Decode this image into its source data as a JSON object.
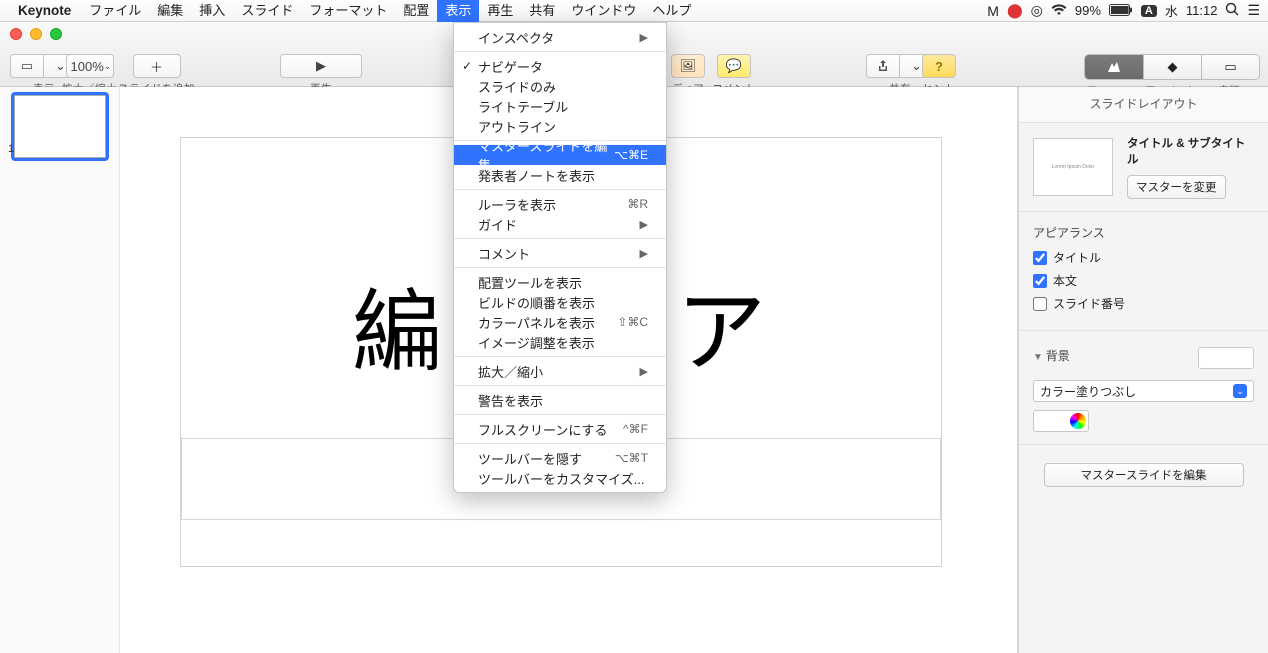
{
  "menubar": {
    "appname": "Keynote",
    "items": [
      "ファイル",
      "編集",
      "挿入",
      "スライド",
      "フォーマット",
      "配置",
      "表示",
      "再生",
      "共有",
      "ウインドウ",
      "ヘルプ"
    ],
    "open_index": 6,
    "battery": "99%",
    "input_badge": "A",
    "day": "水",
    "clock": "11:12"
  },
  "toolbar": {
    "view_label": "表示",
    "zoom_value": "100%",
    "zoom_label": "拡大／縮小",
    "addslide_label": "スライドを追加",
    "play_label": "再生",
    "media_label": "ディア",
    "comment_label": "コメント",
    "share_label": "共有",
    "hint_label": "ヒント",
    "tab_format": "フォーマット",
    "tab_anim": "アニメーション",
    "tab_doc": "書類"
  },
  "dropdown": {
    "inspector": "インスペクタ",
    "navigator": "ナビゲータ",
    "slideonly": "スライドのみ",
    "lighttable": "ライトテーブル",
    "outline": "アウトライン",
    "master_edit": "マスタースライドを編集",
    "master_edit_sc": "⌥⌘E",
    "presenter_notes": "発表者ノートを表示",
    "ruler": "ルーラを表示",
    "ruler_sc": "⌘R",
    "guide": "ガイド",
    "comment": "コメント",
    "layout_tools": "配置ツールを表示",
    "build_order": "ビルドの順番を表示",
    "color_panel": "カラーパネルを表示",
    "color_panel_sc": "⇧⌘C",
    "image_adjust": "イメージ調整を表示",
    "zoom": "拡大／縮小",
    "warnings": "警告を表示",
    "fullscreen": "フルスクリーンにする",
    "fullscreen_sc": "^⌘F",
    "hide_tb": "ツールバーを隠す",
    "hide_tb_sc": "⌥⌘T",
    "customize_tb": "ツールバーをカスタマイズ..."
  },
  "slide": {
    "number": "1",
    "title_text_left": "編",
    "title_text_right": "ア"
  },
  "inspector": {
    "header": "スライドレイアウト",
    "preview_text": "Lorem Ipsum Dolor",
    "layout_name": "タイトル & サブタイトル",
    "change_master": "マスターを変更",
    "appearance": "アピアランス",
    "show_title": "タイトル",
    "show_body": "本文",
    "show_slidenum": "スライド番号",
    "background": "背景",
    "fill_type": "カラー塗りつぶし",
    "edit_master": "マスタースライドを編集"
  }
}
